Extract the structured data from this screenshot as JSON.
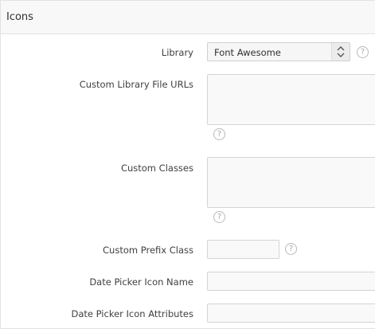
{
  "region": {
    "title": "Icons"
  },
  "library": {
    "label": "Library",
    "value": "Font Awesome"
  },
  "custom_library_file_urls": {
    "label": "Custom Library File URLs",
    "value": ""
  },
  "custom_classes": {
    "label": "Custom Classes",
    "value": ""
  },
  "custom_prefix_class": {
    "label": "Custom Prefix Class",
    "value": ""
  },
  "date_picker_icon_name": {
    "label": "Date Picker Icon Name",
    "value": ""
  },
  "date_picker_icon_attributes": {
    "label": "Date Picker Icon Attributes",
    "value": ""
  },
  "icons": {
    "help": "help-icon",
    "select": "chevron-up-down-icon"
  },
  "help_glyph": "?"
}
